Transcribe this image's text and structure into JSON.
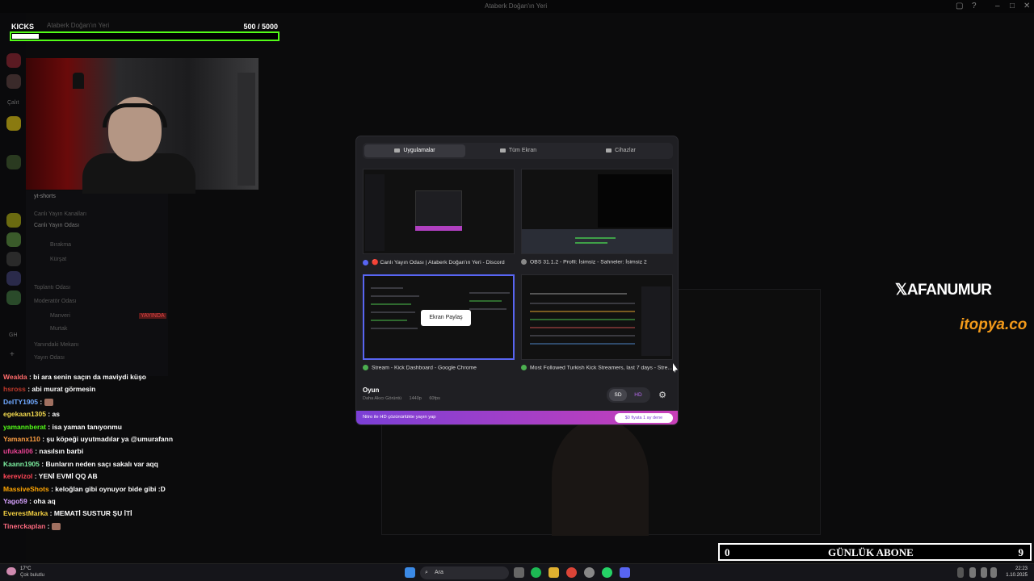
{
  "window": {
    "title": "Ataberk Doğan'ın Yeri"
  },
  "kicks": {
    "label": "KICKS",
    "server": "Ataberk Doğan'ın Yeri",
    "count": "500  / 5000",
    "progress": 0.1
  },
  "sidebar": {
    "section_label": "Çalıt",
    "channel_yt": "yt-shorts",
    "category_voice": "Canlı Yayın Kanalları",
    "channel_live": "Canlı Yayın Odası",
    "user_a": "Bırakma",
    "user_b": "Kürşat",
    "channel_meet": "Toplantı Odası",
    "channel_mod": "Moderatör Odası",
    "user_c": "Manveri",
    "user_d": "Murtak",
    "badge_live": "YAYINDA",
    "channel_music": "Yanındaki Mekanı",
    "channel_game": "Yayın Odası",
    "left_label": "GH"
  },
  "chat": [
    {
      "user": "Wealda",
      "color": "#ff6b6b",
      "text": " : bi ara senin saçın da maviydi küşo",
      "emote": false
    },
    {
      "user": "hsross",
      "color": "#c0392b",
      "text": " : abi murat görmesin",
      "emote": false
    },
    {
      "user": "DeITY1905",
      "color": "#6fa8ff",
      "text": " : ",
      "emote": true
    },
    {
      "user": "egekaan1305",
      "color": "#f2d94e",
      "text": " : as",
      "emote": false
    },
    {
      "user": "yamannberat",
      "color": "#53fc18",
      "text": " : isa yaman tanıyonmu",
      "emote": false
    },
    {
      "user": "Yamanx110",
      "color": "#ff9f43",
      "text": " : şu köpeği uyutmadılar ya @umurafann",
      "emote": false
    },
    {
      "user": "ufukali06",
      "color": "#e84393",
      "text": " : nasılsın barbi",
      "emote": false
    },
    {
      "user": "Kaann1905",
      "color": "#7bed9f",
      "text": " : Bunların neden saçı sakalı var aqq",
      "emote": false
    },
    {
      "user": "kerevizol",
      "color": "#ff4757",
      "text": " : YENİ EVMİ QQ AB",
      "emote": false
    },
    {
      "user": "MassiveShots",
      "color": "#ffa502",
      "text": " : keloğlan gibi oynuyor bide gibi :D",
      "emote": false
    },
    {
      "user": "Yago59",
      "color": "#d6a2ff",
      "text": " : oha aq",
      "emote": false
    },
    {
      "user": "EverestMarka",
      "color": "#f5d142",
      "text": " : MEMATİ SUSTUR ŞU İTİ",
      "emote": false
    },
    {
      "user": "Tinerckaplan",
      "color": "#ff6b81",
      "text": " : ",
      "emote": true
    }
  ],
  "picker": {
    "tabs": [
      {
        "label": "Uygulamalar",
        "active": true
      },
      {
        "label": "Tüm Ekran",
        "active": false
      },
      {
        "label": "Cihazlar",
        "active": false
      }
    ],
    "windows": [
      {
        "title": "🔴 Canlı Yayın Odası | Ataberk Doğan'ın Yeri - Discord",
        "icon_color": "#5865f2"
      },
      {
        "title": "OBS 31.1.2 - Profil: İsimsiz - Sahneler: İsimsiz 2",
        "icon_color": "#888888"
      },
      {
        "title": "Stream - Kick Dashboard - Google Chrome",
        "icon_color": "#4caf50"
      },
      {
        "title": "Most Followed Turkish Kick Streamers, last 7 days - Stre...",
        "icon_color": "#4caf50"
      }
    ],
    "share_button": "Ekran Paylaş",
    "quality": {
      "title": "Oyun",
      "subtitle": "Daha Akıcı Görüntü",
      "resolution": "1440p",
      "fps": "60fps",
      "sd": "SD",
      "hd": "HD"
    },
    "nitro": {
      "text": "Nitro ile HD çözünürlükte yayın yap",
      "button": "$0 fiyata 1 ay dene"
    }
  },
  "overlay": {
    "x_handle": "AFANUMUR",
    "brand": "itopya.co"
  },
  "abone": {
    "left": "0",
    "label": "GÜNLÜK ABONE",
    "right": "9"
  },
  "taskbar": {
    "temp": "17°C",
    "weather": "Çok bulutlu",
    "search": "Ara",
    "time": "22:23",
    "date": "1.10.2025"
  },
  "colors": {
    "accent": "#5865f2",
    "kick_green": "#53fc18",
    "nitro_start": "#7b3fd6",
    "nitro_end": "#c93fb8"
  }
}
